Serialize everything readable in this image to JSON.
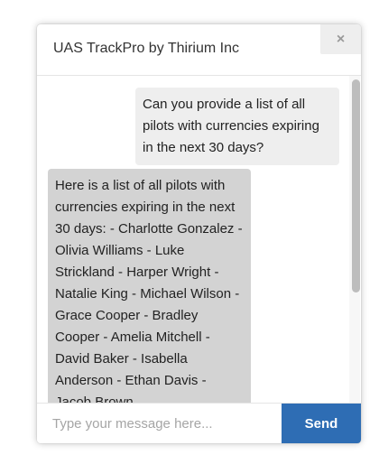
{
  "header": {
    "title": "UAS TrackPro by Thirium Inc",
    "close_label": "×"
  },
  "messages": [
    {
      "role": "user",
      "text": "Can you provide a list of all pilots with currencies expiring in the next 30 days?"
    },
    {
      "role": "assistant",
      "text": "Here is a list of all pilots with currencies expiring in the next 30 days: - Charlotte Gonzalez - Olivia Williams - Luke Strickland - Harper Wright - Natalie King - Michael Wilson - Grace Cooper - Bradley Cooper - Amelia Mitchell - David Baker - Isabella Anderson - Ethan Davis - Jacob Brown"
    }
  ],
  "composer": {
    "placeholder": "Type your message here...",
    "value": "",
    "send_label": "Send"
  },
  "colors": {
    "accent": "#2e6db4",
    "user_bubble": "#eeeeee",
    "assistant_bubble": "#d3d3d3"
  }
}
